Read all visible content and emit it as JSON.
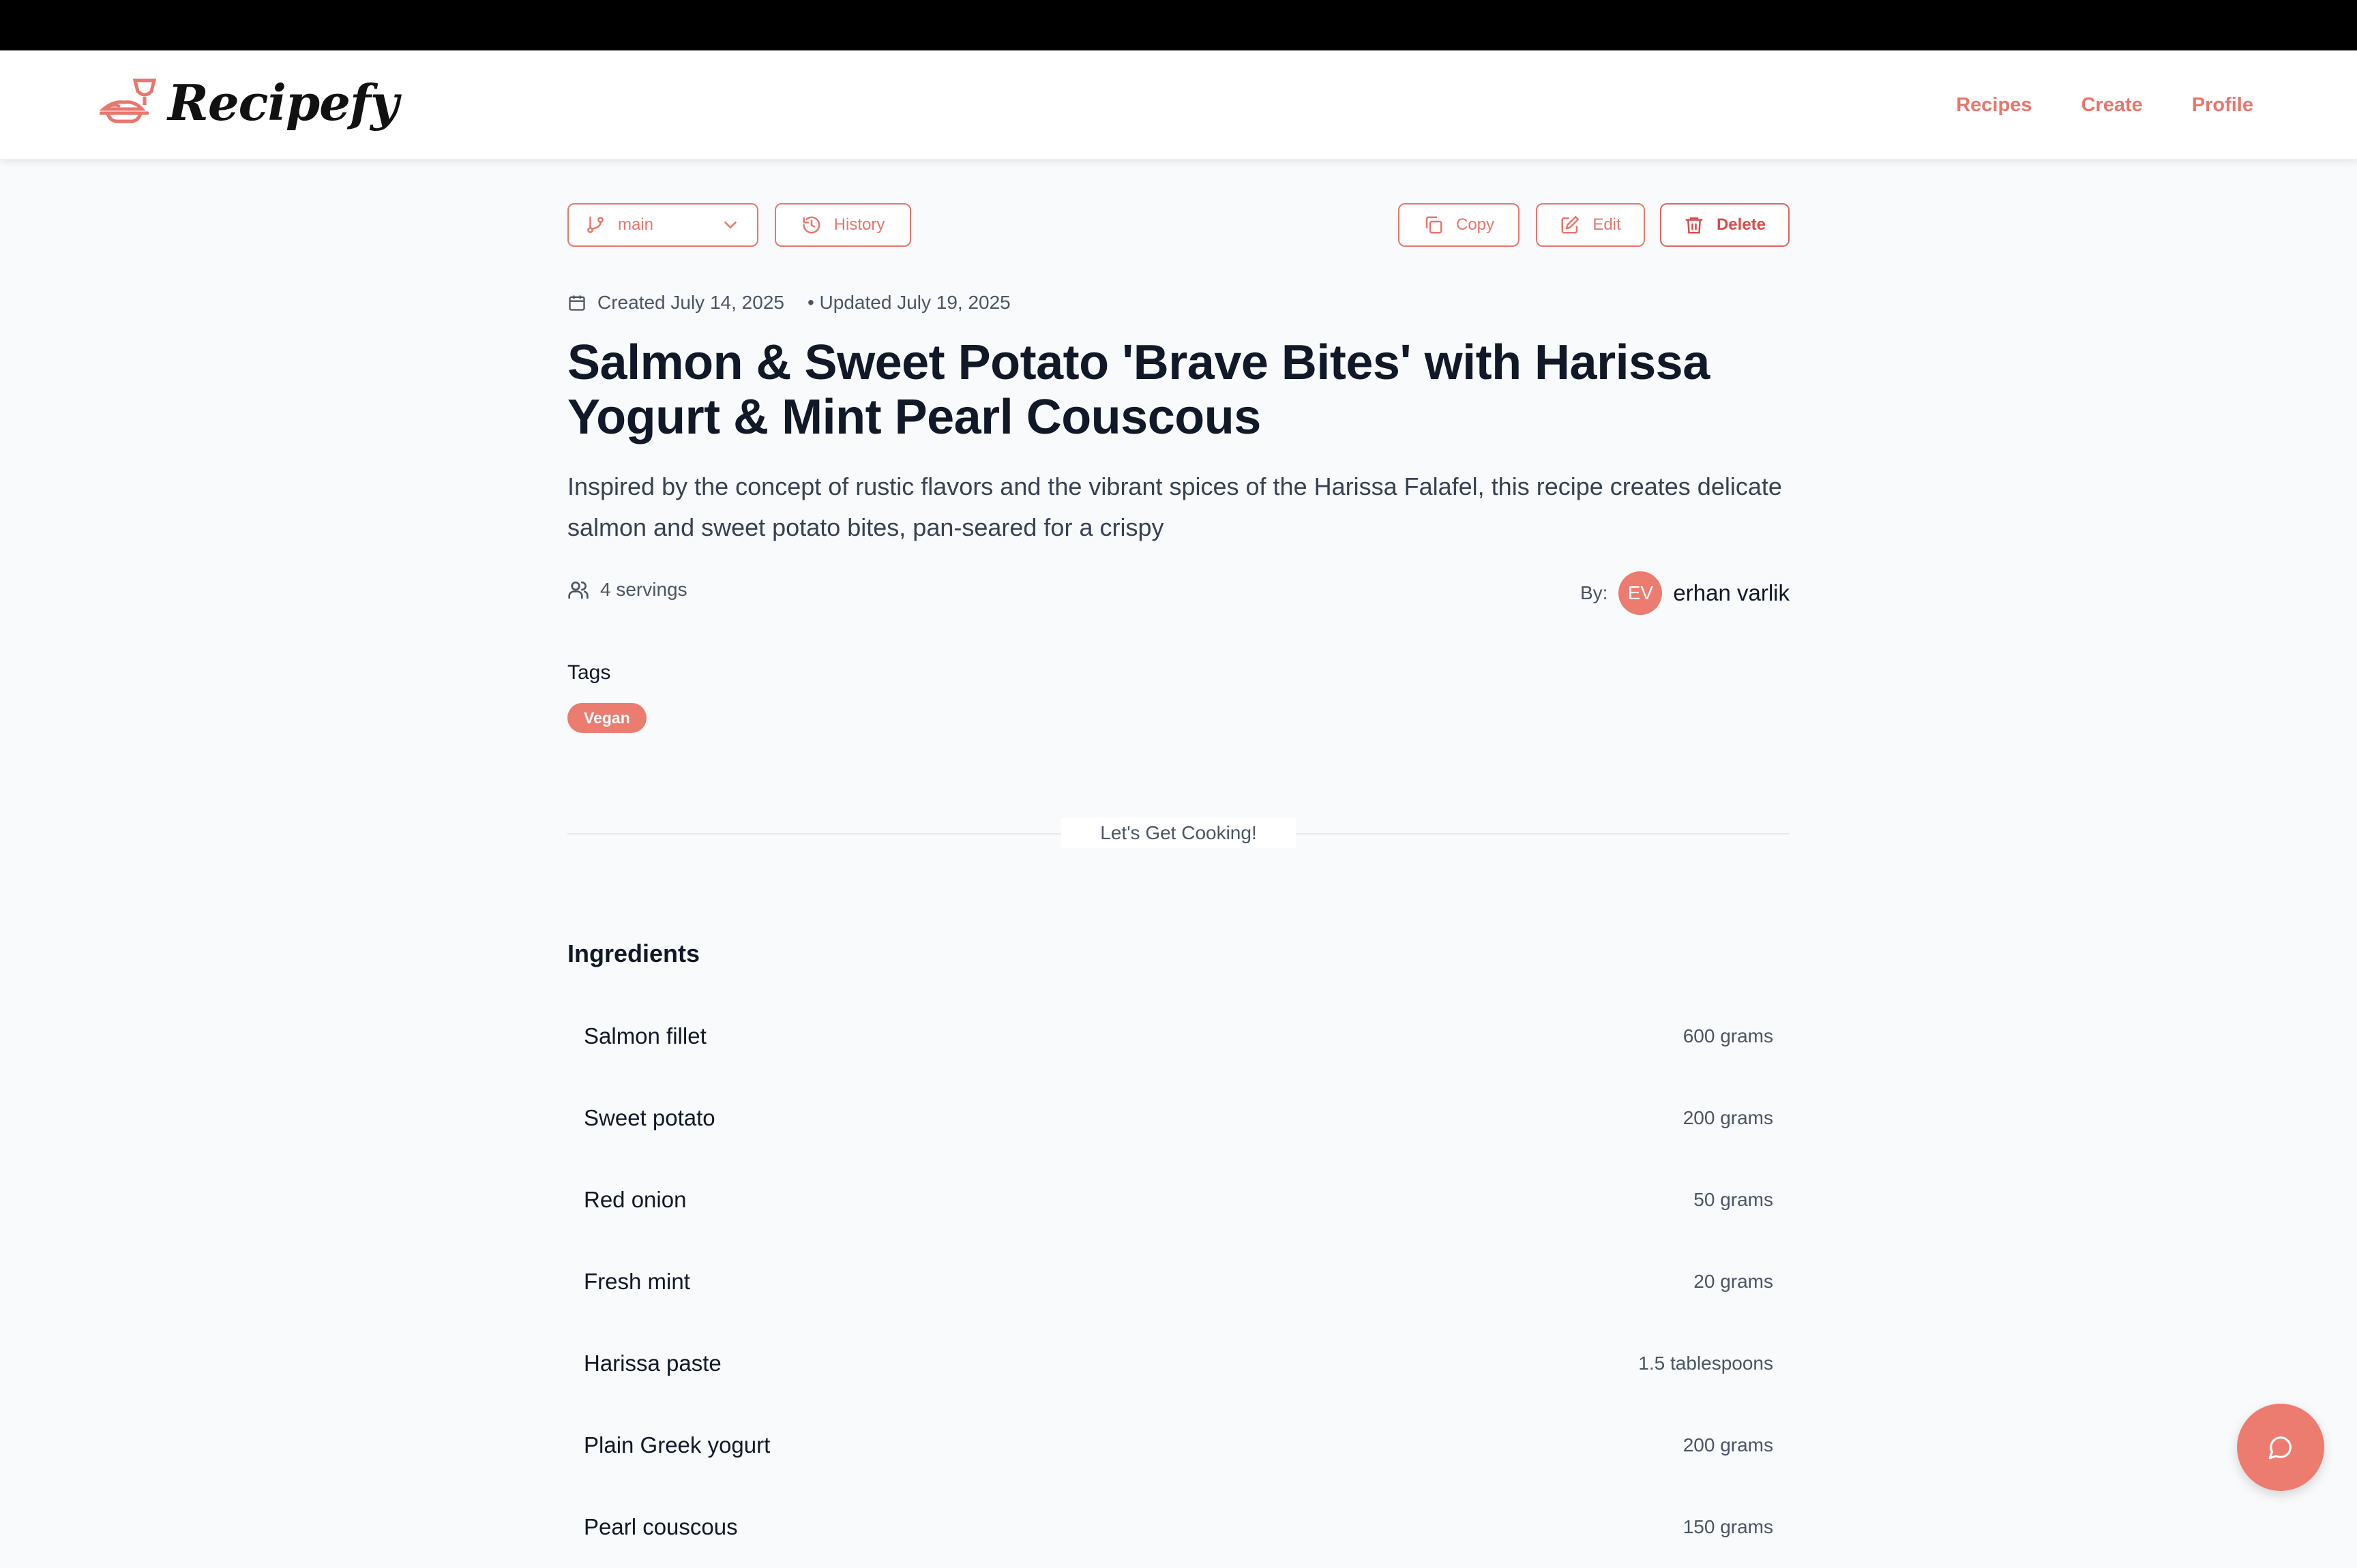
{
  "header": {
    "logo_text": "Recipefy",
    "nav": [
      "Recipes",
      "Create",
      "Profile"
    ]
  },
  "toolbar": {
    "branch": "main",
    "history_label": "History",
    "copy_label": "Copy",
    "edit_label": "Edit",
    "delete_label": "Delete"
  },
  "meta": {
    "created": "Created July 14, 2025",
    "updated": "• Updated July 19, 2025"
  },
  "recipe": {
    "title": "Salmon & Sweet Potato 'Brave Bites' with Harissa Yogurt & Mint Pearl Couscous",
    "description": "Inspired by the concept of rustic flavors and the vibrant spices of the Harissa Falafel, this recipe creates delicate salmon and sweet potato bites, pan-seared for a crispy",
    "servings": "4 servings",
    "author_label": "By:",
    "author_initials": "EV",
    "author_name": "erhan varlik",
    "tags_label": "Tags",
    "tags": [
      "Vegan"
    ]
  },
  "divider_label": "Let's Get Cooking!",
  "ingredients": {
    "title": "Ingredients",
    "items": [
      {
        "name": "Salmon fillet",
        "qty": "600 grams"
      },
      {
        "name": "Sweet potato",
        "qty": "200 grams"
      },
      {
        "name": "Red onion",
        "qty": "50 grams"
      },
      {
        "name": "Fresh mint",
        "qty": "20 grams"
      },
      {
        "name": "Harissa paste",
        "qty": "1.5 tablespoons"
      },
      {
        "name": "Plain Greek yogurt",
        "qty": "200 grams"
      },
      {
        "name": "Pearl couscous",
        "qty": "150 grams"
      }
    ]
  },
  "colors": {
    "accent": "#e8766c",
    "danger": "#dc4b4b",
    "background": "#f9fafb"
  },
  "icons": {
    "branch": "git-branch-icon",
    "history": "history-icon",
    "copy": "copy-icon",
    "edit": "edit-icon",
    "delete": "trash-icon",
    "calendar": "calendar-icon",
    "servings": "users-icon",
    "chat": "chat-icon"
  }
}
